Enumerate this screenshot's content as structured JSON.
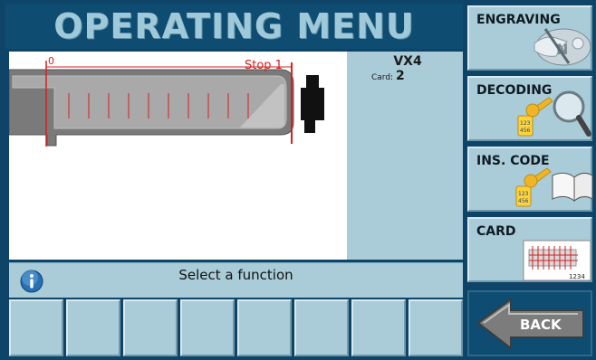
{
  "header": {
    "title": "OPERATING MENU"
  },
  "key_view": {
    "zero_label": "0",
    "stop_label": "Stop 1"
  },
  "info_panel": {
    "model": "VX4",
    "card_label": "Card:",
    "card_number": "2"
  },
  "status": {
    "message": "Select a function",
    "icon": "info-icon"
  },
  "bottom_buttons": {
    "count": 8
  },
  "functions": [
    {
      "label": "ENGRAVING",
      "icon": "key-engraving-icon"
    },
    {
      "label": "DECODING",
      "icon": "magnifier-keys-icon"
    },
    {
      "label": "INS. CODE",
      "icon": "book-keys-icon"
    },
    {
      "label": "CARD",
      "icon": "card-key-icon",
      "card_code": "1234"
    }
  ],
  "back": {
    "label": "BACK",
    "icon": "back-arrow-icon"
  },
  "colors": {
    "background": "#0e4467",
    "title_text": "#9fc9d8",
    "panel": "#a9ccd8",
    "marker_red": "#d42020"
  }
}
